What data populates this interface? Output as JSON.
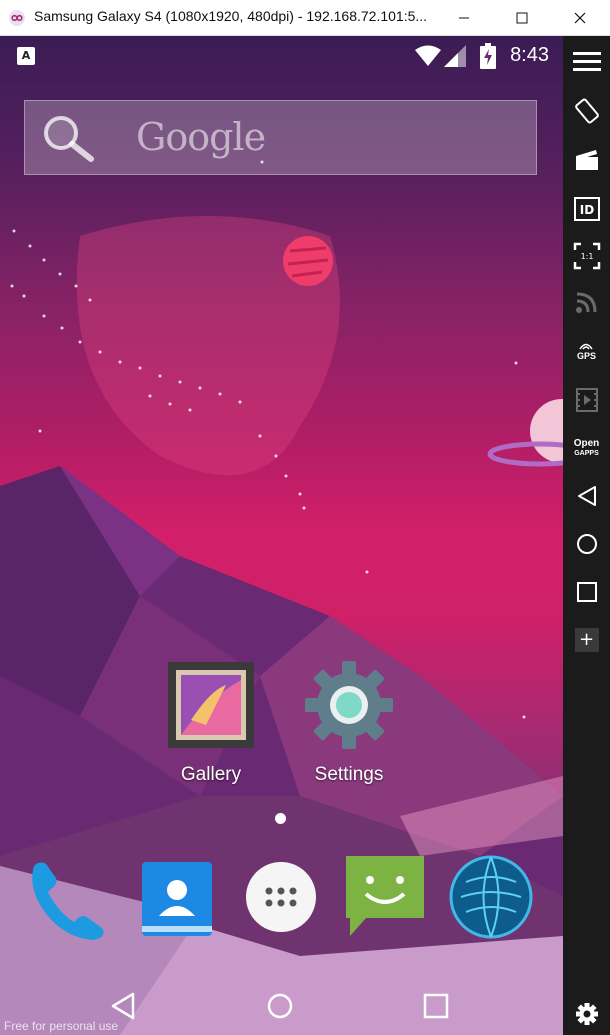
{
  "window": {
    "title": "Samsung Galaxy S4 (1080x1920, 480dpi) - 192.168.72.101:5...",
    "minimize": "—",
    "maximize": "☐",
    "close": "✕"
  },
  "status_bar": {
    "notification_icon": "A",
    "time": "8:43"
  },
  "search_widget": {
    "label": "Google",
    "icon": "magnifier-icon"
  },
  "apps": [
    {
      "label": "Gallery",
      "icon": "gallery-icon"
    },
    {
      "label": "Settings",
      "icon": "settings-gear-icon"
    }
  ],
  "dock": [
    {
      "name": "phone",
      "icon": "phone-icon"
    },
    {
      "name": "contacts",
      "icon": "contacts-icon"
    },
    {
      "name": "all-apps",
      "icon": "app-drawer-icon"
    },
    {
      "name": "messaging",
      "icon": "message-icon"
    },
    {
      "name": "browser",
      "icon": "globe-icon"
    }
  ],
  "navbar": {
    "back": "back-icon",
    "home": "home-icon",
    "recents": "recents-icon"
  },
  "watermark": "Free for personal use",
  "sidebar": {
    "items": [
      {
        "name": "menu",
        "icon": "hamburger-icon"
      },
      {
        "name": "rotate",
        "icon": "rotate-icon"
      },
      {
        "name": "screencast",
        "icon": "clapperboard-icon"
      },
      {
        "name": "device-id",
        "icon": "id-icon",
        "text": "ID"
      },
      {
        "name": "pixel-perfect",
        "icon": "scale-icon",
        "text": "1:1"
      },
      {
        "name": "cast",
        "icon": "cast-icon"
      },
      {
        "name": "gps",
        "icon": "gps-icon",
        "text": "GPS"
      },
      {
        "name": "media",
        "icon": "film-icon"
      },
      {
        "name": "open-gapps",
        "icon": "opengapps-icon",
        "text": "Open",
        "subtext": "GAPPS"
      },
      {
        "name": "back",
        "icon": "back-icon"
      },
      {
        "name": "home",
        "icon": "home-icon"
      },
      {
        "name": "recents",
        "icon": "recents-icon"
      },
      {
        "name": "add",
        "icon": "plus-icon",
        "text": "+"
      },
      {
        "name": "settings",
        "icon": "gear-icon"
      }
    ]
  },
  "colors": {
    "sidebar_bg": "#1b1b1b",
    "accent_pink": "#d31f69"
  }
}
